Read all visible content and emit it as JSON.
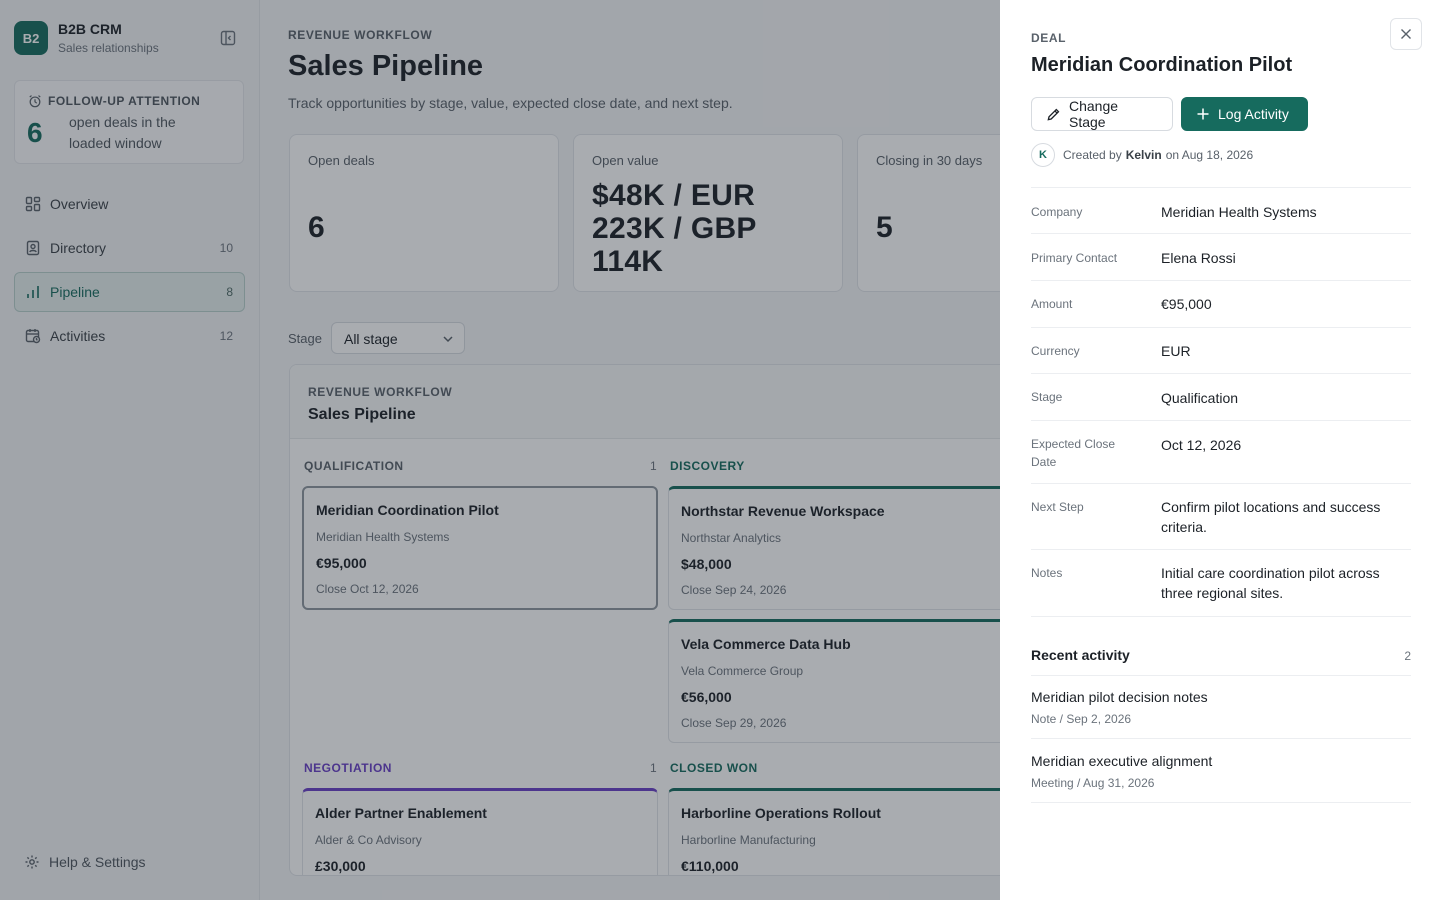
{
  "app": {
    "logo": "B2",
    "name": "B2B CRM",
    "subtitle": "Sales relationships"
  },
  "followup": {
    "heading": "FOLLOW-UP ATTENTION",
    "count": "6",
    "text": "open deals in the loaded window"
  },
  "nav": {
    "items": [
      {
        "label": "Overview",
        "count": "",
        "icon": "grid-icon"
      },
      {
        "label": "Directory",
        "count": "10",
        "icon": "contact-book-icon"
      },
      {
        "label": "Pipeline",
        "count": "8",
        "icon": "bar-chart-icon",
        "active": true
      },
      {
        "label": "Activities",
        "count": "12",
        "icon": "calendar-clock-icon"
      }
    ],
    "help": "Help & Settings"
  },
  "page": {
    "eyebrow": "REVENUE WORKFLOW",
    "title": "Sales Pipeline",
    "description": "Track opportunities by stage, value, expected close date, and next step."
  },
  "stats": [
    {
      "label": "Open deals",
      "value": "6"
    },
    {
      "label": "Open value",
      "value_lines": [
        "$48K / EUR",
        "223K / GBP",
        "114K"
      ]
    },
    {
      "label": "Closing in 30 days",
      "value": "5"
    }
  ],
  "filter": {
    "label": "Stage",
    "selected": "All stage"
  },
  "board": {
    "eyebrow": "REVENUE WORKFLOW",
    "title": "Sales Pipeline",
    "columns": [
      {
        "name": "QUALIFICATION",
        "count": "1",
        "color": "#59616a",
        "cards": [
          {
            "title": "Meridian Coordination Pilot",
            "company": "Meridian Health Systems",
            "amount": "€95,000",
            "close": "Close Oct 12, 2026"
          }
        ]
      },
      {
        "name": "DISCOVERY",
        "count": "",
        "color": "#166b5e",
        "cards": [
          {
            "title": "Northstar Revenue Workspace",
            "company": "Northstar Analytics",
            "amount": "$48,000",
            "close": "Close Sep 24, 2026"
          },
          {
            "title": "Vela Commerce Data Hub",
            "company": "Vela Commerce Group",
            "amount": "€56,000",
            "close": "Close Sep 29, 2026"
          }
        ]
      },
      {
        "name": "NEGOTIATION",
        "count": "1",
        "color": "#6a3fc7",
        "cards": [
          {
            "title": "Alder Partner Enablement",
            "company": "Alder & Co Advisory",
            "amount": "£30,000",
            "close": ""
          }
        ]
      },
      {
        "name": "CLOSED WON",
        "count": "",
        "color": "#166b5e",
        "cards": [
          {
            "title": "Harborline Operations Rollout",
            "company": "Harborline Manufacturing",
            "amount": "€110,000",
            "close": ""
          }
        ]
      }
    ]
  },
  "drawer": {
    "eyebrow": "DEAL",
    "title": "Meridian Coordination Pilot",
    "change_stage": "Change Stage",
    "log_activity": "Log Activity",
    "creator_initial": "K",
    "created_prefix": "Created by",
    "created_by": "Kelvin",
    "created_suffix": "on Aug 18, 2026",
    "details": [
      {
        "label": "Company",
        "value": "Meridian Health Systems"
      },
      {
        "label": "Primary Contact",
        "value": "Elena Rossi"
      },
      {
        "label": "Amount",
        "value": "€95,000"
      },
      {
        "label": "Currency",
        "value": "EUR"
      },
      {
        "label": "Stage",
        "value": "Qualification"
      },
      {
        "label": "Expected Close Date",
        "value": "Oct 12, 2026"
      },
      {
        "label": "Next Step",
        "value": "Confirm pilot locations and success criteria."
      },
      {
        "label": "Notes",
        "value": "Initial care coordination pilot across three regional sites."
      }
    ],
    "recent_activity": {
      "heading": "Recent activity",
      "count": "2",
      "items": [
        {
          "title": "Meridian pilot decision notes",
          "meta": "Note / Sep 2, 2026"
        },
        {
          "title": "Meridian executive alignment",
          "meta": "Meeting / Aug 31, 2026"
        }
      ]
    }
  },
  "colors": {
    "brand": "#166b5e",
    "negotiation": "#6a3fc7"
  }
}
